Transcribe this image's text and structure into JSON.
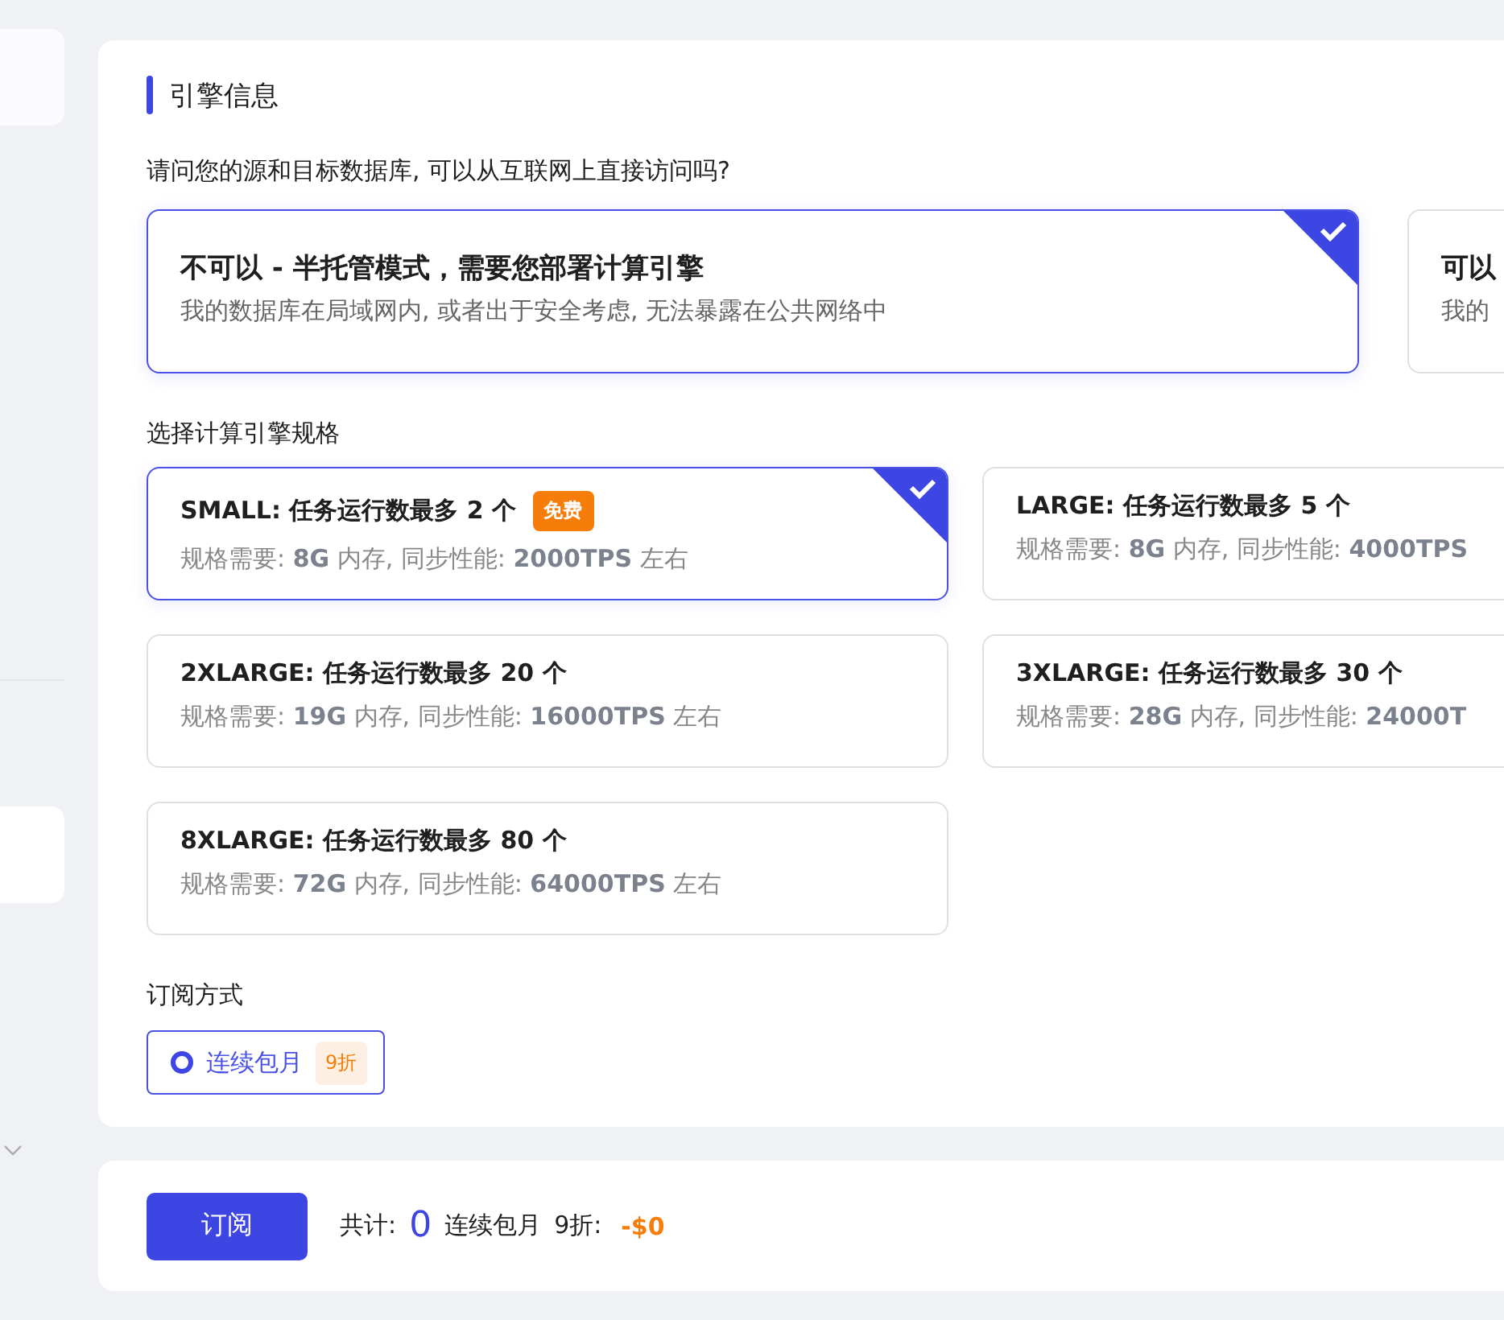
{
  "section": {
    "title": "引擎信息"
  },
  "access": {
    "question": "请问您的源和目标数据库, 可以从互联网上直接访问吗?",
    "options": [
      {
        "title": "不可以 - 半托管模式，需要您部署计算引擎",
        "description": "我的数据库在局域网内, 或者出于安全考虑, 无法暴露在公共网络中",
        "selected": true
      },
      {
        "title": "可以",
        "description": "我的",
        "selected": false
      }
    ]
  },
  "specs": {
    "label": "选择计算引擎规格",
    "options": [
      {
        "title": "SMALL: 任务运行数最多 2 个",
        "badge": "免费",
        "description": "规格需要: **8G** 内存, 同步性能: **2000TPS** 左右",
        "selected": true
      },
      {
        "title": "LARGE: 任务运行数最多 5 个",
        "description": "规格需要: **8G** 内存, 同步性能: **4000TPS**",
        "selected": false
      },
      {
        "title": "2XLARGE: 任务运行数最多 20 个",
        "description": "规格需要: **19G** 内存, 同步性能: **16000TPS** 左右",
        "selected": false
      },
      {
        "title": "3XLARGE: 任务运行数最多 30 个",
        "description": "规格需要: **28G** 内存, 同步性能: **24000T**",
        "selected": false
      },
      {
        "title": "8XLARGE: 任务运行数最多 80 个",
        "description": "规格需要: **72G** 内存, 同步性能: **64000TPS** 左右",
        "selected": false
      }
    ]
  },
  "subscription": {
    "label": "订阅方式",
    "options": [
      {
        "label": "连续包月",
        "badge": "9折",
        "selected": true
      }
    ]
  },
  "footer": {
    "button": "订阅",
    "total_label": "共计:",
    "total": "0",
    "plan": "连续包月",
    "discount": "9折:",
    "price": "-$0"
  }
}
